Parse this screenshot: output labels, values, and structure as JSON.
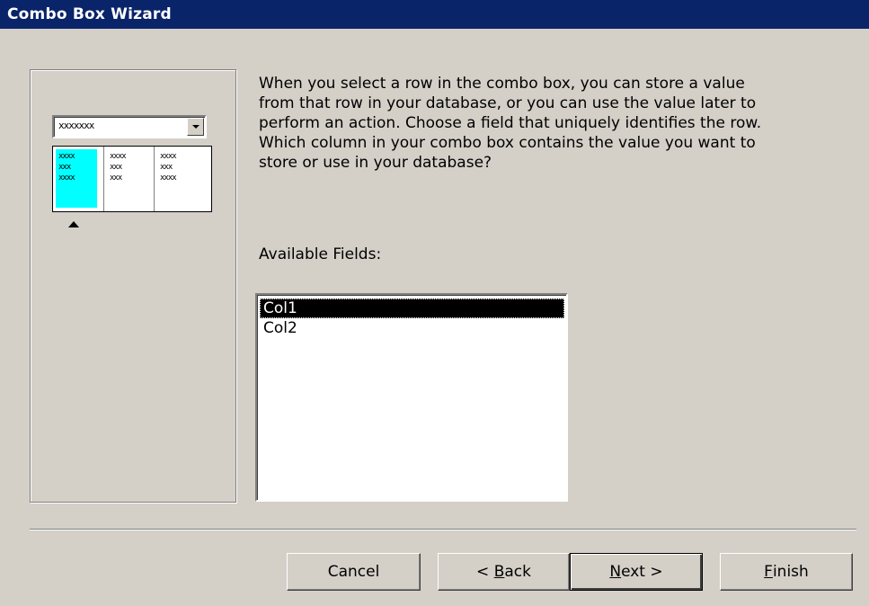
{
  "window": {
    "title": "Combo Box Wizard"
  },
  "preview": {
    "combo_text": "xxxxxxx",
    "columns": [
      [
        "xxxx",
        "xxx",
        "xxxx"
      ],
      [
        "xxxx",
        "xxx",
        "xxx"
      ],
      [
        "xxxx",
        "xxx",
        "xxxx"
      ]
    ],
    "highlight_color": "#00ffff"
  },
  "instructions": "When you select a row in the combo box, you can store a value\nfrom that row in your database, or you can use the value later to\nperform an action.  Choose a field that uniquely identifies the row.\nWhich column in your combo box contains the value you want to\nstore or use in your database?",
  "fields": {
    "label": "Available Fields:",
    "items": [
      "Col1",
      "Col2"
    ],
    "selected": "Col1"
  },
  "buttons": {
    "cancel": "Cancel",
    "back_prefix": "< ",
    "back_mnemonic": "B",
    "back_rest": "ack",
    "next_mnemonic": "N",
    "next_rest": "ext >",
    "finish_mnemonic": "F",
    "finish_rest": "inish"
  }
}
